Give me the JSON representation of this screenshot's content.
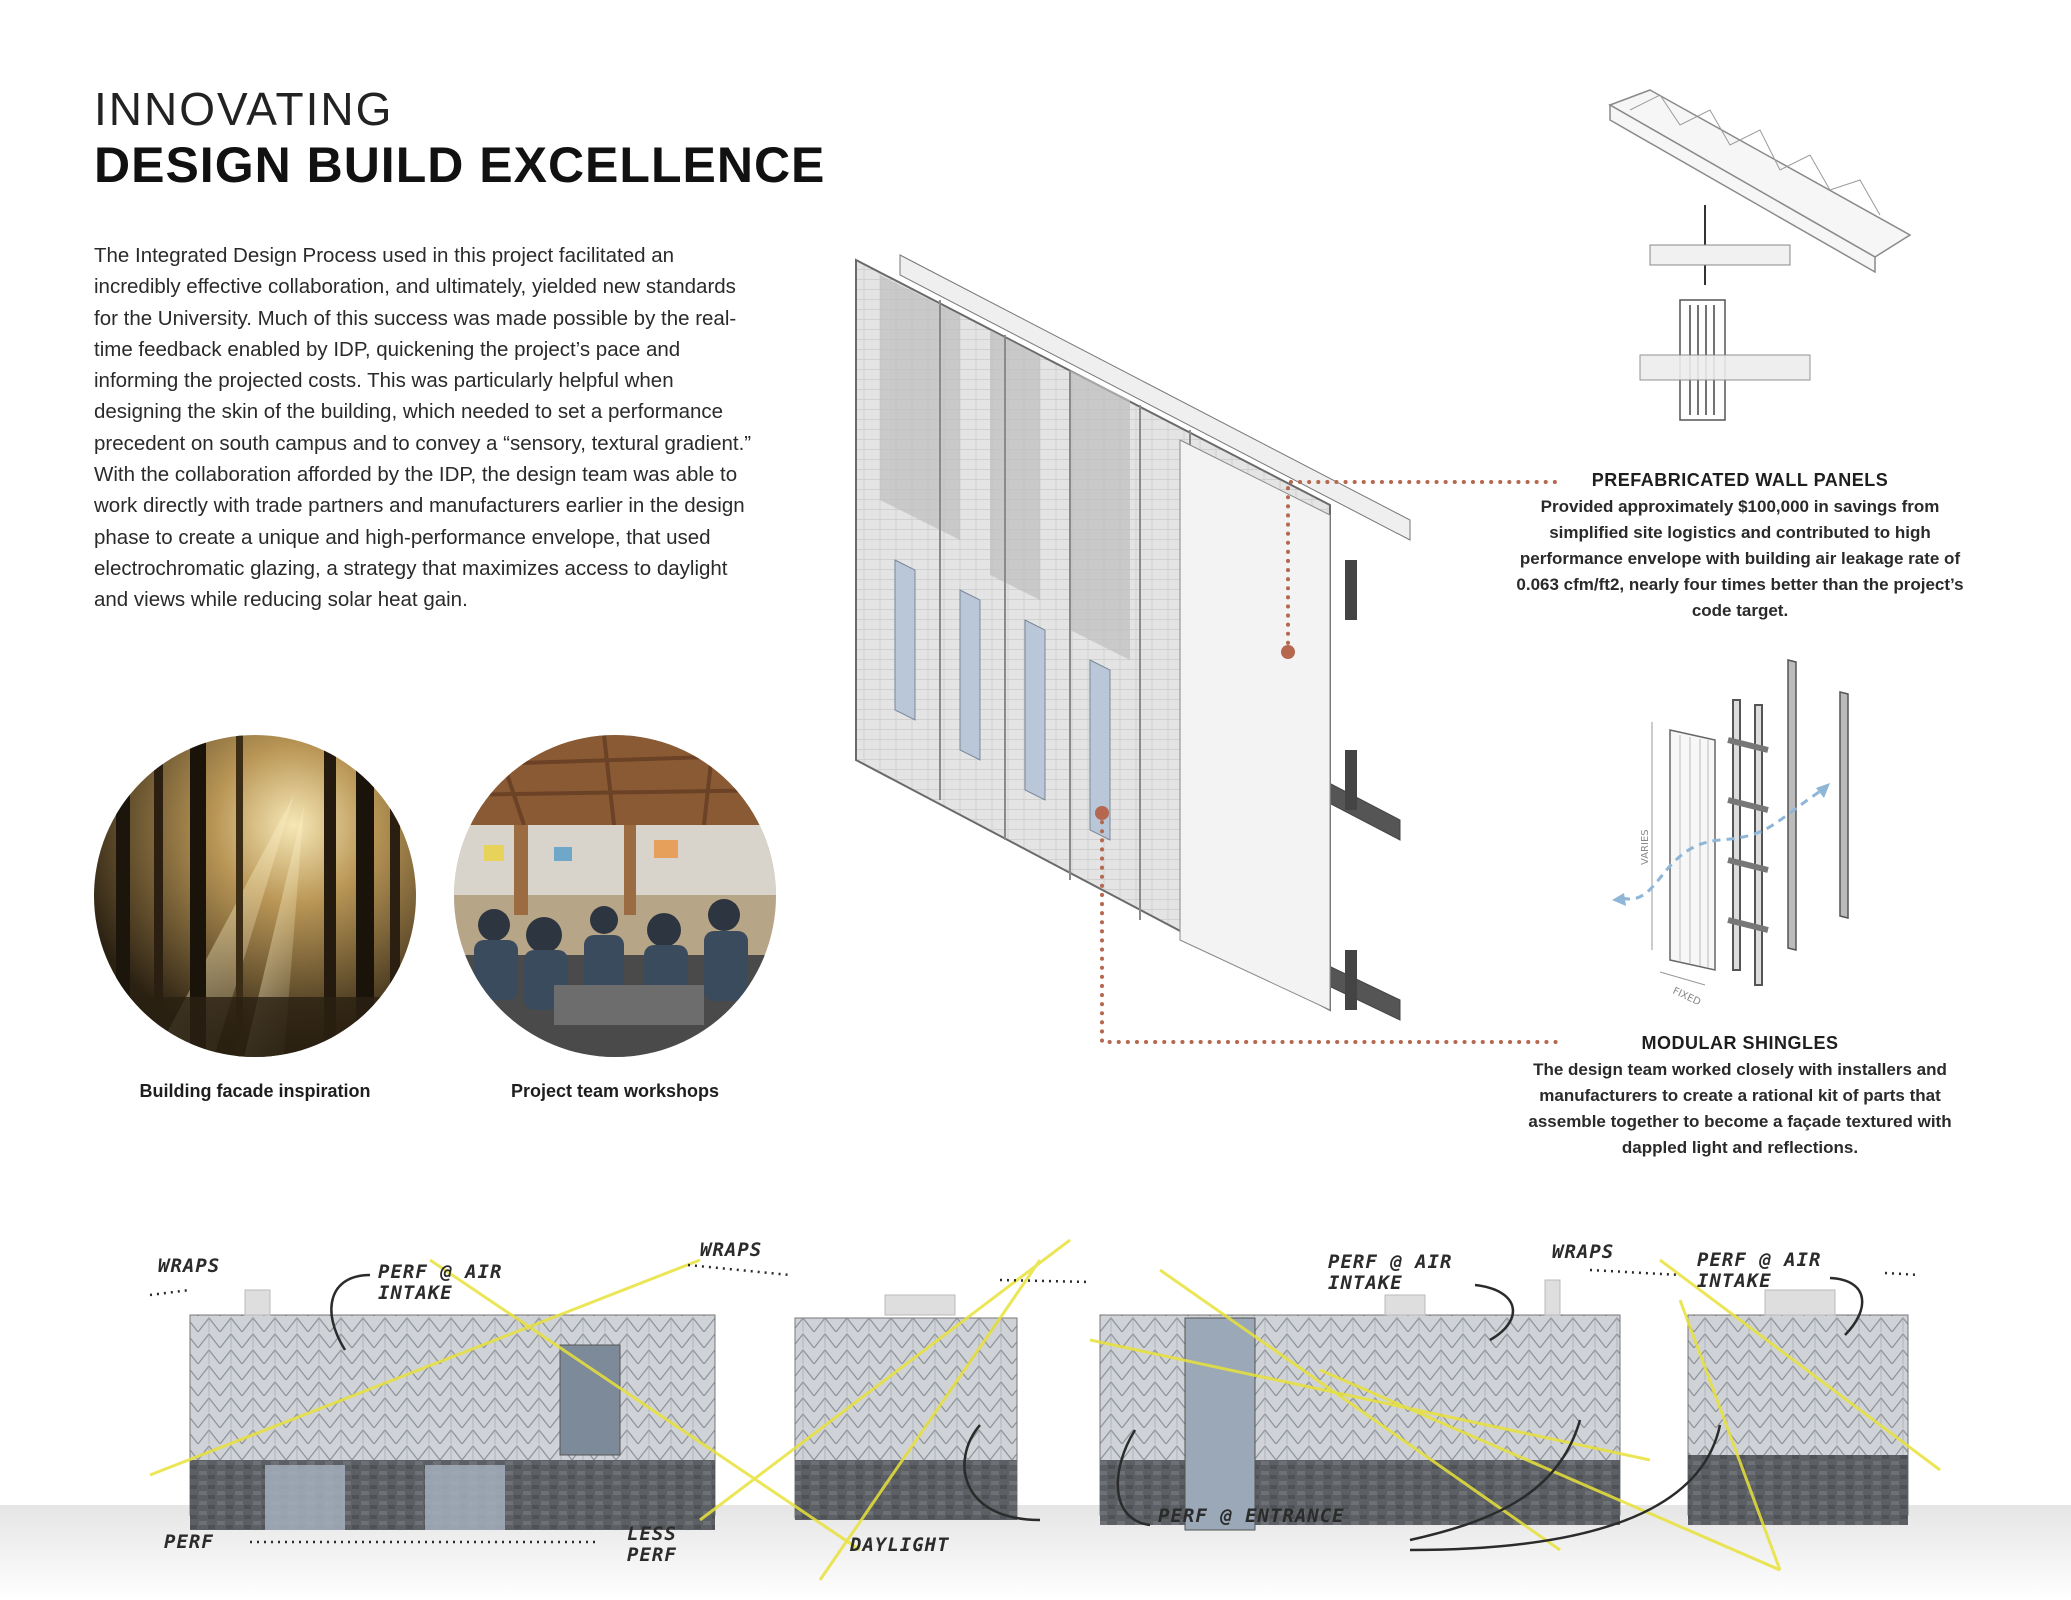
{
  "header": {
    "title_light": "INNOVATING",
    "title_bold": "DESIGN BUILD EXCELLENCE"
  },
  "intro": {
    "paragraph": "The Integrated Design Process used in this project facilitated an incredibly effective collaboration, and ultimately, yielded new standards for the University. Much of this success was made possible by the real-time feedback enabled by IDP, quickening the project’s pace and informing the projected costs. This was particularly helpful when designing the skin of the building, which needed to set a performance precedent on south campus and to convey a “sensory, textural gradient.” With the collaboration afforded by the IDP, the design team was able to work directly with trade partners and manufacturers earlier in the design phase to create a unique and high-performance envelope, that used electrochromatic glazing, a strategy that maximizes access to daylight and views while reducing solar heat gain."
  },
  "photos": [
    {
      "caption": "Building facade inspiration"
    },
    {
      "caption": "Project team workshops"
    }
  ],
  "callouts": {
    "wall_panels": {
      "heading": "PREFABRICATED WALL PANELS",
      "body": "Provided approximately $100,000 in savings from simplified site logistics and contributed to high performance envelope with building air leakage rate of 0.063 cfm/ft2, nearly four times better than the project’s code target."
    },
    "shingles": {
      "heading": "MODULAR SHINGLES",
      "body": "The design team worked closely with installers and manufacturers to create a rational kit of parts that assemble together to become a façade textured with dappled light and reflections."
    }
  },
  "diagram_labels": {
    "varies": "VARIES",
    "fixed": "FIXED"
  },
  "annotations": {
    "wraps_1": "WRAPS",
    "perf_air_1": "PERF @ AIR INTAKE",
    "wraps_2": "WRAPS",
    "perf_air_2": "PERF @ AIR INTAKE",
    "wraps_3": "WRAPS",
    "perf_air_3": "PERF @ AIR INTAKE",
    "perf": "PERF",
    "less_perf": "LESS PERF",
    "daylight": "DAYLIGHT",
    "perf_entrance": "PERF @ ENTRANCE"
  },
  "colors": {
    "accent_dot": "#b5684f",
    "sun_ray": "#e8e23a",
    "air_flow": "#8fb6d6"
  }
}
